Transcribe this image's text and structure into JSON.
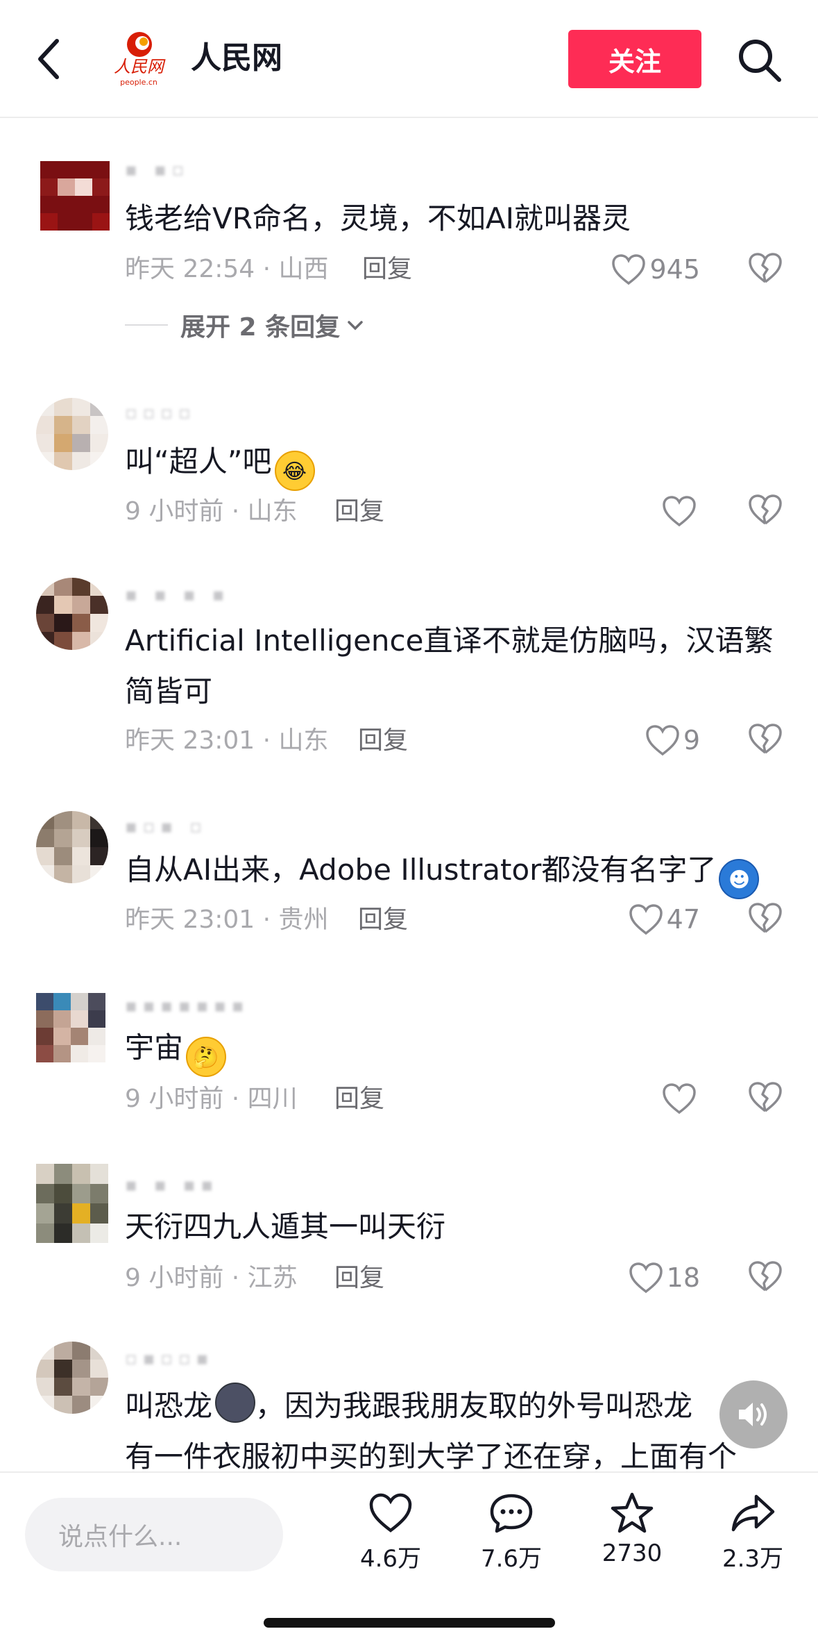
{
  "header": {
    "title": "人民网",
    "logo_text": "人民网",
    "logo_sub": "people.cn",
    "follow_label": "关注",
    "accent": "#fe2c55"
  },
  "comments": [
    {
      "text": "钱老给VR命名，灵境，不如AI就叫器灵",
      "meta": "昨天 22:54 · 山西",
      "reply": "回复",
      "likes": "945",
      "expand": "展开 2 条回复"
    },
    {
      "text": "叫“超人”吧",
      "emoji": "laughing-crying-emoji",
      "meta": "9 小时前 · 山东",
      "reply": "回复",
      "likes": ""
    },
    {
      "text": "Artificial Intelligence直译不就是仿脑吗，汉语繁简皆可",
      "meta": "昨天 23:01 · 山东",
      "reply": "回复",
      "likes": "9"
    },
    {
      "text": "自从AI出来，Adobe Illustrator都没有名字了",
      "emoji": "blue-hair-emoji",
      "meta": "昨天 23:01 · 贵州",
      "reply": "回复",
      "likes": "47"
    },
    {
      "text": "宇宙",
      "emoji": "thinking-face-emoji",
      "meta": "9 小时前 · 四川",
      "reply": "回复",
      "likes": ""
    },
    {
      "text": "天衍四九人遁其一叫天衍",
      "meta": "9 小时前 · 江苏",
      "reply": "回复",
      "likes": "18"
    },
    {
      "text_before_emoji": "叫恐龙",
      "emoji": "new-moon-face-emoji",
      "text_after_emoji": "，因为我跟我朋友取的外号叫恐龙",
      "text_line2": "有一件衣服初中买的到大学了还在穿，上面有个"
    }
  ],
  "bottom_bar": {
    "input_placeholder": "说点什么...",
    "likes": "4.6万",
    "comments": "7.6万",
    "favorites": "2730",
    "shares": "2.3万"
  }
}
